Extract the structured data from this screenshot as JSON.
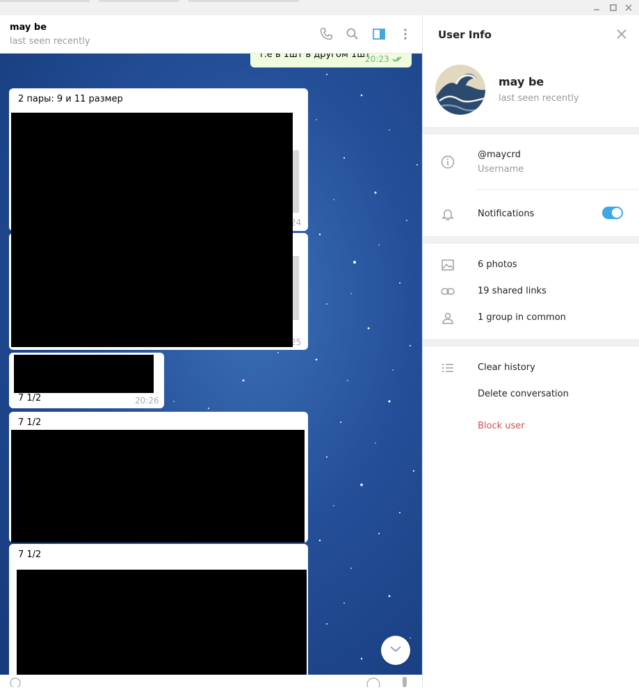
{
  "window": {
    "minimize_icon": "minimize-icon",
    "maximize_icon": "maximize-icon",
    "close_icon": "close-icon"
  },
  "chat": {
    "name": "may be",
    "status": "last seen recently",
    "icons": [
      "phone-icon",
      "search-icon",
      "sidebar-toggle-icon",
      "more-vertical-icon"
    ]
  },
  "messages": {
    "outgoing_text": "т.е в 1шт в другом 1шт",
    "outgoing_time": "20:23",
    "album_caption": "2 пары: 9 и 11 размер",
    "partial_time_1": "24",
    "partial_time_2": "25",
    "msg3_caption": "7 1/2",
    "msg3_time": "20:26",
    "msg4_caption": "7 1/2",
    "msg5_caption": "7 1/2"
  },
  "panel": {
    "title": "User Info",
    "name": "may be",
    "status": "last seen recently",
    "username": "@maycrd",
    "username_label": "Username",
    "notifications_label": "Notifications",
    "notifications_on": true,
    "photos": "6 photos",
    "links": "19 shared links",
    "groups": "1 group in common",
    "clear_history": "Clear history",
    "delete_conversation": "Delete conversation",
    "block_user": "Block user"
  },
  "colors": {
    "accent": "#40a7e3",
    "danger": "#d14e4e",
    "muted": "#999999",
    "read_ticks": "#4dae4f"
  }
}
